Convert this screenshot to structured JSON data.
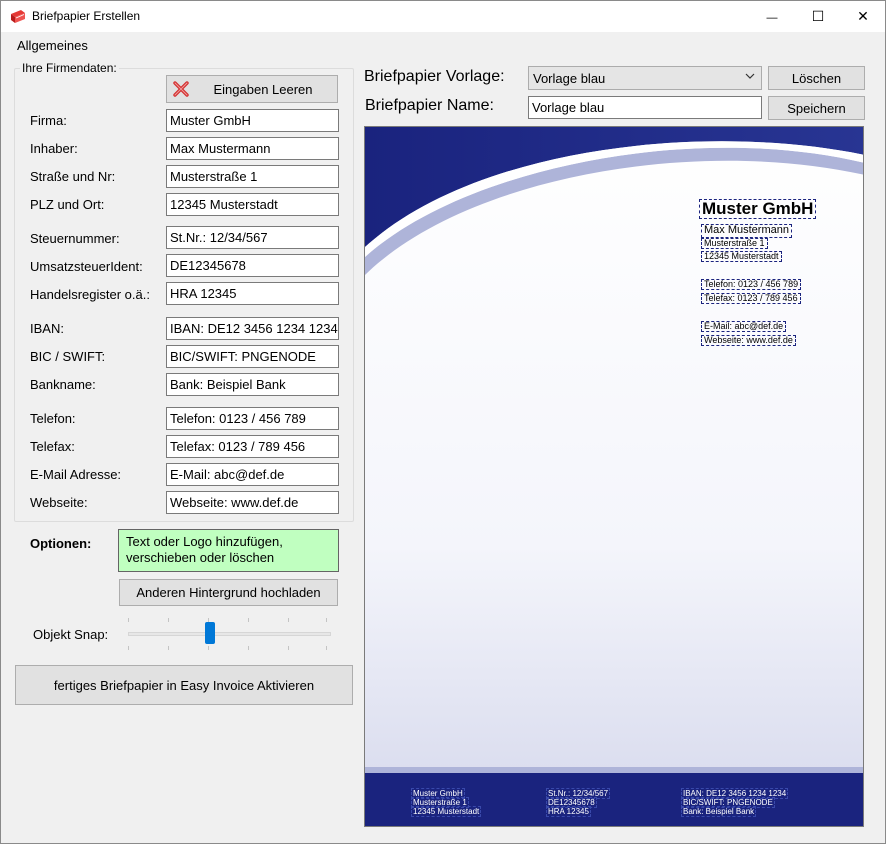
{
  "window": {
    "title": "Briefpapier Erstellen",
    "minimize_glyph": "—",
    "maximize_glyph": "☐",
    "close_glyph": "✕"
  },
  "menu": {
    "items": [
      {
        "label": "Allgemeines"
      }
    ]
  },
  "company_group": {
    "legend": "Ihre Firmendaten:",
    "clear_button": "Eingaben Leeren",
    "fields": [
      {
        "label": "Firma:",
        "value": "Muster GmbH"
      },
      {
        "label": "Inhaber:",
        "value": "Max Mustermann"
      },
      {
        "label": "Straße und Nr:",
        "value": "Musterstraße 1"
      },
      {
        "label": "PLZ und Ort:",
        "value": "12345 Musterstadt"
      },
      {
        "label": "Steuernummer:",
        "value": "St.Nr.: 12/34/567"
      },
      {
        "label": "UmsatzsteuerIdent:",
        "value": "DE12345678"
      },
      {
        "label": "Handelsregister o.ä.:",
        "value": "HRA 12345"
      },
      {
        "label": "IBAN:",
        "value": "IBAN: DE12 3456 1234 1234"
      },
      {
        "label": "BIC  / SWIFT:",
        "value": "BIC/SWIFT: PNGENODE"
      },
      {
        "label": "Bankname:",
        "value": "Bank: Beispiel Bank"
      },
      {
        "label": "Telefon:",
        "value": "Telefon: 0123 / 456 789"
      },
      {
        "label": "Telefax:",
        "value": "Telefax: 0123 / 789 456"
      },
      {
        "label": "E-Mail Adresse:",
        "value": "E-Mail: abc@def.de"
      },
      {
        "label": "Webseite:",
        "value": "Webseite: www.def.de"
      }
    ]
  },
  "options": {
    "label": "Optionen:",
    "hint_text": "Text oder Logo hinzufügen, verschieben oder löschen",
    "upload_button": "Anderen Hintergrund hochladen",
    "snap_label": "Objekt Snap:",
    "snap_level": 0.4,
    "activate_button": "fertiges Briefpapier in Easy Invoice Aktivieren"
  },
  "template": {
    "vorlage_label": "Briefpapier Vorlage:",
    "vorlage_value": "Vorlage blau",
    "delete_button": "Löschen",
    "name_label": "Briefpapier Name:",
    "name_value": "Vorlage blau",
    "save_button": "Speichern"
  },
  "preview": {
    "header_block": {
      "company": "Muster GmbH",
      "owner": "Max Mustermann",
      "street": "Musterstraße 1",
      "city": "12345 Musterstadt",
      "phone": "Telefon: 0123 / 456 789",
      "fax": "Telefax: 0123 / 789 456",
      "email": "E-Mail: abc@def.de",
      "web": "Webseite: www.def.de"
    },
    "footer": {
      "col1": [
        "Muster GmbH",
        "Musterstraße 1",
        "12345 Musterstadt"
      ],
      "col2": [
        "St.Nr.: 12/34/567",
        "DE12345678",
        "HRA 12345"
      ],
      "col3": [
        "IBAN: DE12 3456 1234 1234",
        "BIC/SWIFT: PNGENODE",
        "Bank: Beispiel Bank"
      ]
    }
  },
  "colors": {
    "accent": "#0078d7",
    "navy": "#1a237e",
    "hint_bg": "#c0ffc0",
    "clear_icon": "#d32f2f"
  }
}
